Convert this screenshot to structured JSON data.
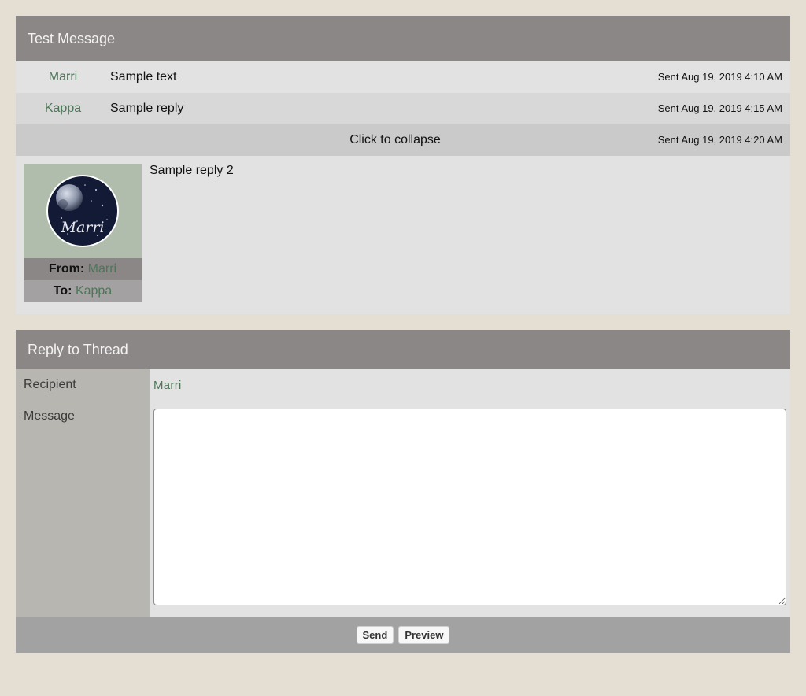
{
  "thread": {
    "title": "Test Message",
    "messages": [
      {
        "from": "Marri",
        "text": "Sample text",
        "sent": "Sent Aug 19, 2019 4:10 AM"
      },
      {
        "from": "Kappa",
        "text": "Sample reply",
        "sent": "Sent Aug 19, 2019 4:15 AM"
      }
    ],
    "collapse_row": {
      "label": "Click to collapse",
      "sent": "Sent Aug 19, 2019 4:20 AM"
    },
    "expanded": {
      "text": "Sample reply 2",
      "avatar_text": "Marri",
      "from_label": "From:",
      "from_user": "Marri",
      "to_label": "To:",
      "to_user": "Kappa"
    }
  },
  "reply": {
    "title": "Reply to Thread",
    "recipient_label": "Recipient",
    "recipient_value": "Marri",
    "message_label": "Message",
    "message_value": "",
    "send_label": "Send",
    "preview_label": "Preview"
  },
  "colors": {
    "page_bg": "#e5dfd3",
    "header_bg": "#8b8787",
    "link": "#4d7658"
  }
}
